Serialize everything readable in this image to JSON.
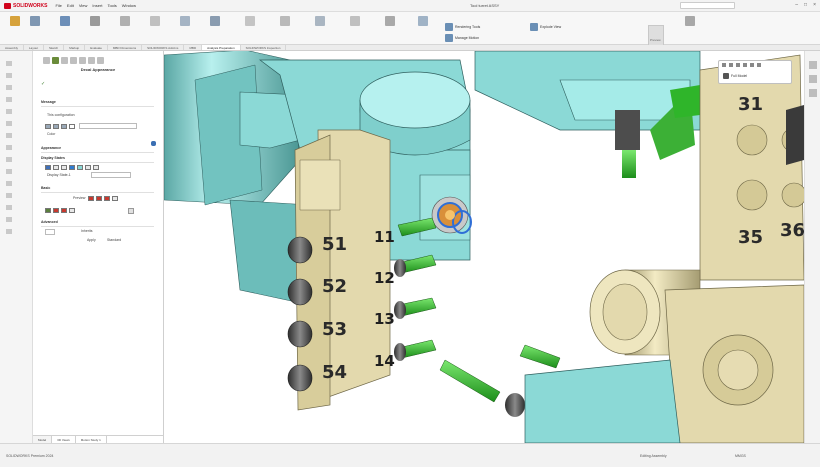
{
  "app": {
    "brand": "SOLIDWORKS",
    "window_title": "Tool turret ASSY",
    "menu": [
      "File",
      "Edit",
      "View",
      "Insert",
      "Tools",
      "Window"
    ]
  },
  "ribbon": {
    "buttons": [
      "Rendering Tools",
      "Manage Motion",
      "Explode View"
    ],
    "big_button": "Preview"
  },
  "tabs": {
    "items": [
      "Assembly",
      "Layout",
      "Sketch",
      "Markup",
      "Evaluate",
      "MBD Dimensions",
      "SOLIDWORKS Add-Ins",
      "MBD",
      "Analysis Preparation",
      "SOLIDWORKS Inspection"
    ],
    "active_index": 8
  },
  "property_manager": {
    "title": "Decal Appearance",
    "sections": {
      "message": "Message",
      "appearance": "Appearance",
      "display_states": "Display States",
      "basic": "Basic",
      "advanced": "Advanced"
    },
    "labels": {
      "this_config": "This configuration",
      "color": "Color",
      "display_state": "Display State-1",
      "preview": "Preview",
      "apply": "Apply to",
      "standard": "Standard",
      "opt_a": "Inherits",
      "opt_b": "Apply"
    },
    "bottom_tabs": [
      "Model",
      "3D Views",
      "Motion Study 1"
    ],
    "active_bottom_tab": 0
  },
  "viewport": {
    "position_labels": [
      "11",
      "12",
      "13",
      "14",
      "51",
      "52",
      "53",
      "54",
      "31",
      "35",
      "36"
    ]
  },
  "hud": {
    "label": "Full Model"
  },
  "statusbar": {
    "left": "SOLIDWORKS Premium 2024",
    "right": "Editing Assembly",
    "units": "MMGS"
  },
  "colors": {
    "teal": "#8bd9d6",
    "beige": "#e3d9ad",
    "green": "#2fb52a",
    "dark": "#4d4d4d"
  }
}
